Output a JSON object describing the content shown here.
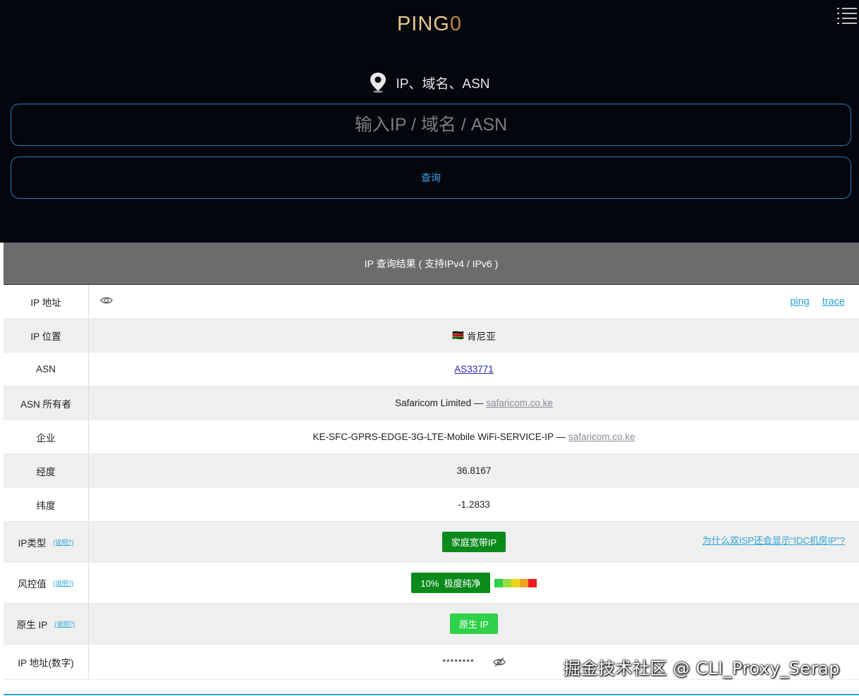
{
  "header": {
    "logo_text": "PING",
    "logo_zero": "0",
    "search_label": "IP、域名、ASN",
    "search_placeholder": "输入IP / 域名 / ASN",
    "query_button": "查询"
  },
  "result": {
    "title": "IP 查询结果 ( 支持IPv4 / IPv6 )",
    "ip_label": "IP 地址",
    "ping_link": "ping",
    "trace_link": "trace",
    "location_label": "IP 位置",
    "location_flag": "🇰🇪",
    "location_value": "肯尼亚",
    "asn_label": "ASN",
    "asn_value": "AS33771",
    "asn_owner_label": "ASN 所有者",
    "asn_owner_value": "Safaricom Limited —",
    "asn_owner_domain": "safaricom.co.ke",
    "org_label": "企业",
    "org_value": "KE-SFC-GPRS-EDGE-3G-LTE-Mobile WiFi-SERVICE-IP —",
    "org_domain": "safaricom.co.ke",
    "lon_label": "经度",
    "lon_value": "36.8167",
    "lat_label": "纬度",
    "lat_value": "-1.2833",
    "type_label": "IP类型",
    "type_note": "(说明?)",
    "type_value": "家庭宽带IP",
    "type_isp_link": "为什么双ISP还会显示\"IDC机房IP\"?",
    "risk_label": "风控值",
    "risk_note": "(说明?)",
    "risk_value": "10%  极度纯净",
    "risk_level": 0.1,
    "risk_colors": [
      "#2ed14a",
      "#9ddc3a",
      "#e8d81b",
      "#f0a024",
      "#ec1c1c"
    ],
    "native_label": "原生 IP",
    "native_note": "(说明?)",
    "native_value": "原生 IP",
    "numeric_label": "IP 地址(数字)",
    "numeric_value": "********"
  },
  "watermark": "掘金技术社区 @ CLI_Proxy_Serap",
  "colors": {
    "accent": "#2ca4d9",
    "badge_green": "#0b8a1c",
    "badge_light_green": "#2ed14a",
    "header_bg": "#03060d"
  }
}
